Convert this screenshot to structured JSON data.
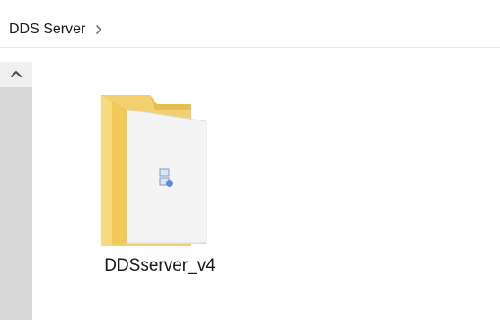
{
  "breadcrumb": {
    "items": [
      "DDS Server"
    ],
    "separator_icon": "chevron-right-icon"
  },
  "scrollbar": {
    "up_icon": "chevron-up-icon"
  },
  "files": [
    {
      "name": "DDSserver_v4",
      "type": "folder",
      "icon": "folder-icon"
    }
  ],
  "colors": {
    "folder_tab": "#e9c65a",
    "folder_back": "#f5d57d",
    "document": "#f7f7f7"
  }
}
